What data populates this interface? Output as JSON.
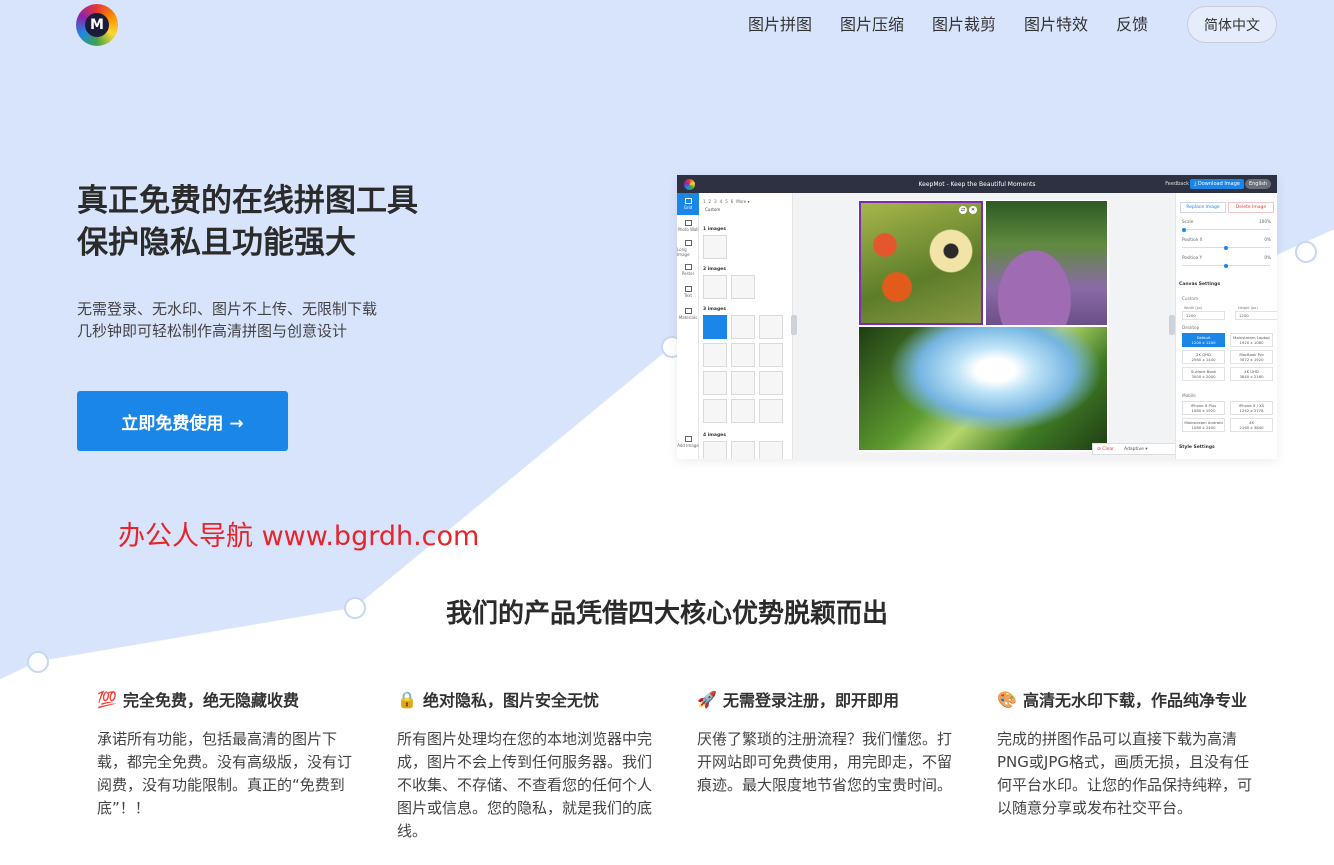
{
  "header": {
    "logo_letter": "M",
    "nav": [
      "图片拼图",
      "图片压缩",
      "图片裁剪",
      "图片特效",
      "反馈"
    ],
    "lang_button": "简体中文"
  },
  "hero": {
    "title_line1": "真正免费的在线拼图工具",
    "title_line2": "保护隐私且功能强大",
    "sub_line1": "无需登录、无水印、图片不上传、无限制下载",
    "sub_line2": "几秒钟即可轻松制作高清拼图与创意设计",
    "cta": "立即免费使用 →"
  },
  "watermark": "办公人导航 www.bgrdh.com",
  "screenshot": {
    "title": "KeepMot - Keep the Beautiful Moments",
    "feedback": "Feedback",
    "download": "⤓ Download Image",
    "english": "English",
    "tools": [
      "Grid",
      "Photo Wall",
      "Long Image",
      "Poster",
      "Text",
      "Materials"
    ],
    "add_image": "Add Image",
    "count_tabs": [
      "1",
      "2",
      "3",
      "4",
      "5",
      "6",
      "More ▾"
    ],
    "custom": "Custom",
    "sections": [
      "1 images",
      "2 images",
      "3 images",
      "4 images"
    ],
    "replace": "Replace Image",
    "delete": "Delete Image",
    "scale": "Scale",
    "scale_val": "100%",
    "pos_x": "Position X",
    "pos_x_val": "0%",
    "pos_y": "Position Y",
    "pos_y_val": "0%",
    "canvas_settings": "Canvas Settings",
    "custom_label": "Custom",
    "width_label": "Width (px)",
    "width_val": "1200",
    "height_label": "Height (px)",
    "height_val": "1200",
    "desktop": "Desktop",
    "mobile": "Mobile",
    "desktop_presets": [
      [
        "Default",
        "1200 x 1200"
      ],
      [
        "Mainstream Laptop",
        "1920 x 1080"
      ],
      [
        "2K QHD",
        "2560 x 1440"
      ],
      [
        "MacBook Pro",
        "3072 x 1920"
      ],
      [
        "Surface Book",
        "3000 x 2000"
      ],
      [
        "4K UHD",
        "3840 x 2160"
      ]
    ],
    "mobile_presets": [
      [
        "iPhone 8 Plus",
        "1080 x 1920"
      ],
      [
        "iPhone X / XS",
        "1242 x 2778"
      ],
      [
        "Mainstream Android",
        "1080 x 2400"
      ],
      [
        "4K",
        "2160 x 3840"
      ]
    ],
    "style_settings": "Style Settings",
    "clear": "⊘ Clear",
    "adaptive": "Adaptive ▾"
  },
  "section": {
    "title": "我们的产品凭借四大核心优势脱颖而出"
  },
  "features": [
    {
      "icon": "💯",
      "icon_name": "hundred-points-icon",
      "title": "完全免费，绝无隐藏收费",
      "body": "承诺所有功能，包括最高清的图片下载，都完全免费。没有高级版，没有订阅费，没有功能限制。真正的“免费到底”！！"
    },
    {
      "icon": "🔒",
      "icon_name": "lock-icon",
      "title": "绝对隐私，图片安全无忧",
      "body": "所有图片处理均在您的本地浏览器中完成，图片不会上传到任何服务器。我们不收集、不存储、不查看您的任何个人图片或信息。您的隐私，就是我们的底线。"
    },
    {
      "icon": "🚀",
      "icon_name": "rocket-icon",
      "title": "无需登录注册，即开即用",
      "body": "厌倦了繁琐的注册流程？我们懂您。打开网站即可免费使用，用完即走，不留痕迹。最大限度地节省您的宝贵时间。"
    },
    {
      "icon": "🎨",
      "icon_name": "palette-icon",
      "title": "高清无水印下载，作品纯净专业",
      "body": "完成的拼图作品可以直接下载为高清PNG或JPG格式，画质无损，且没有任何平台水印。让您的作品保持纯粹，可以随意分享或发布社交平台。"
    }
  ],
  "colors": {
    "hero_bg": "#d7e4fb",
    "accent": "#1a86e8",
    "watermark": "#e8242a"
  }
}
